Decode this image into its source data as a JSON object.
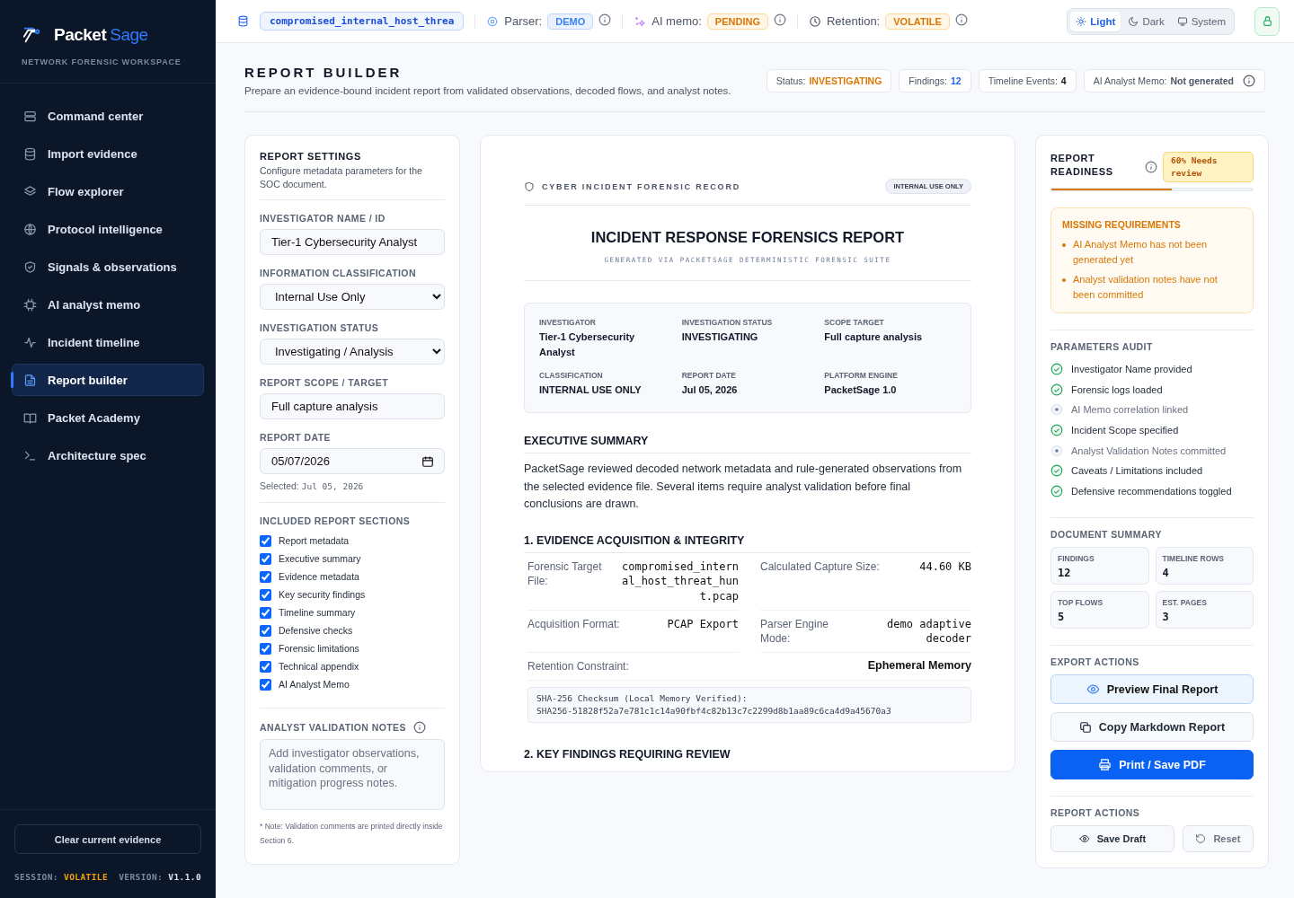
{
  "sidebar": {
    "brand": {
      "name_first": "Packet",
      "name_second": "Sage",
      "tagline": "NETWORK FORENSIC WORKSPACE"
    },
    "nav": [
      {
        "label": "Command center",
        "selected": false
      },
      {
        "label": "Import evidence",
        "selected": false
      },
      {
        "label": "Flow explorer",
        "selected": false
      },
      {
        "label": "Protocol intelligence",
        "selected": false
      },
      {
        "label": "Signals & observations",
        "selected": false
      },
      {
        "label": "AI analyst memo",
        "selected": false
      },
      {
        "label": "Incident timeline",
        "selected": false
      },
      {
        "label": "Report builder",
        "selected": true
      },
      {
        "label": "Packet Academy",
        "selected": false
      },
      {
        "label": "Architecture spec",
        "selected": false
      }
    ],
    "clear_button": "Clear current evidence",
    "session": {
      "label": "SESSION:",
      "value": "VOLATILE"
    },
    "version": {
      "label": "VERSION:",
      "value": "V1.1.0"
    }
  },
  "topbar": {
    "file": "compromised_internal_host_threa",
    "statuses": [
      {
        "label": "Parser:",
        "value": "DEMO",
        "kind": "info"
      },
      {
        "label": "AI memo:",
        "value": "PENDING",
        "kind": "warning"
      },
      {
        "label": "Retention:",
        "value": "VOLATILE",
        "kind": "warning"
      }
    ],
    "theme": [
      {
        "label": "Light",
        "selected": true
      },
      {
        "label": "Dark",
        "selected": false
      },
      {
        "label": "System",
        "selected": false
      }
    ]
  },
  "header": {
    "title": "REPORT BUILDER",
    "subtitle": "Prepare an evidence-bound incident report from validated observations, decoded flows, and analyst notes.",
    "stats": [
      {
        "label": "Status:",
        "value": "INVESTIGATING",
        "kind": "warning"
      },
      {
        "label": "Findings:",
        "value": "12",
        "kind": "info"
      },
      {
        "label": "Timeline Events:",
        "value": "4",
        "kind": "plain"
      },
      {
        "label": "AI Analyst Memo:",
        "value": "Not generated",
        "kind": "muted"
      }
    ]
  },
  "settings": {
    "title": "REPORT SETTINGS",
    "subtitle": "Configure metadata parameters for the SOC document.",
    "fields": [
      {
        "label": "INVESTIGATOR NAME / ID",
        "kind": "text",
        "value": "Tier-1 Cybersecurity Analyst"
      },
      {
        "label": "INFORMATION CLASSIFICATION",
        "kind": "select",
        "value": "Internal Use Only"
      },
      {
        "label": "INVESTIGATION STATUS",
        "kind": "select",
        "value": "Investigating / Analysis"
      },
      {
        "label": "REPORT SCOPE / TARGET",
        "kind": "text",
        "value": "Full capture analysis"
      },
      {
        "label": "REPORT DATE",
        "kind": "date",
        "value": "05/07/2026"
      }
    ],
    "date_hint": {
      "label": "Selected:",
      "value": "Jul 05, 2026"
    },
    "sections_title": "INCLUDED REPORT SECTIONS",
    "sections": [
      {
        "label": "Report metadata",
        "checked": true
      },
      {
        "label": "Executive summary",
        "checked": true
      },
      {
        "label": "Evidence metadata",
        "checked": true
      },
      {
        "label": "Key security findings",
        "checked": true
      },
      {
        "label": "Timeline summary",
        "checked": true
      },
      {
        "label": "Defensive checks",
        "checked": true
      },
      {
        "label": "Forensic limitations",
        "checked": true
      },
      {
        "label": "Technical appendix",
        "checked": true
      },
      {
        "label": "AI Analyst Memo",
        "checked": true
      }
    ],
    "notes": {
      "label": "ANALYST VALIDATION NOTES",
      "placeholder": "Add investigator observations, validation comments, or mitigation progress notes."
    },
    "note": "* Note: Validation comments are printed directly inside Section 6."
  },
  "report": {
    "record_label": "CYBER INCIDENT FORENSIC RECORD",
    "badge": "INTERNAL USE ONLY",
    "title": "INCIDENT RESPONSE FORENSICS REPORT",
    "subtitle": "GENERATED VIA PACKETSAGE DETERMINISTIC FORENSIC SUITE",
    "meta": [
      {
        "label": "INVESTIGATOR",
        "value": "Tier-1 Cybersecurity Analyst"
      },
      {
        "label": "INVESTIGATION STATUS",
        "value": "INVESTIGATING"
      },
      {
        "label": "SCOPE TARGET",
        "value": "Full capture analysis"
      },
      {
        "label": "CLASSIFICATION",
        "value": "INTERNAL USE ONLY"
      },
      {
        "label": "REPORT DATE",
        "value": "Jul 05, 2026"
      },
      {
        "label": "PLATFORM ENGINE",
        "value": "PacketSage 1.0"
      }
    ],
    "summary_title": "EXECUTIVE SUMMARY",
    "summary": "PacketSage reviewed decoded network metadata and rule-generated observations from the selected evidence file. Several items require analyst validation before final conclusions are drawn.",
    "evidence_title": "1. EVIDENCE ACQUISITION & INTEGRITY",
    "evidence": [
      {
        "label": "Forensic Target File:",
        "value": "compromised_internal_host_threat_hunt.pcap",
        "kind": "mono"
      },
      {
        "label": "Calculated Capture Size:",
        "value": "44.60 KB",
        "kind": "mono"
      },
      {
        "label": "Acquisition Format:",
        "value": "PCAP Export",
        "kind": "mono"
      },
      {
        "label": "Parser Engine Mode:",
        "value": "demo adaptive decoder",
        "kind": "mono"
      },
      {
        "label": "Retention Constraint:",
        "value": "Ephemeral Memory",
        "kind": "wide"
      }
    ],
    "checksum_label": "SHA-256 Checksum (Local Memory Verified):",
    "checksum": "SHA256-51828f52a7e781c1c14a90fbf4c82b13c7c2299d8b1aa89c6ca4d9a45670a3",
    "findings_title": "2. KEY FINDINGS REQUIRING REVIEW"
  },
  "readiness": {
    "title": "REPORT READINESS",
    "badge": "60% Needs review",
    "level": 0.6,
    "missing_title": "MISSING REQUIREMENTS",
    "missing": [
      "AI Analyst Memo has not been generated yet",
      "Analyst validation notes have not been committed"
    ],
    "audit_title": "PARAMETERS AUDIT",
    "audit": [
      {
        "label": "Investigator Name provided",
        "checked": true
      },
      {
        "label": "Forensic logs loaded",
        "checked": true
      },
      {
        "label": "AI Memo correlation linked",
        "checked": false
      },
      {
        "label": "Incident Scope specified",
        "checked": true
      },
      {
        "label": "Analyst Validation Notes committed",
        "checked": false
      },
      {
        "label": "Caveats / Limitations included",
        "checked": true
      },
      {
        "label": "Defensive recommendations toggled",
        "checked": true
      }
    ],
    "summary_title": "DOCUMENT SUMMARY",
    "summary": [
      {
        "label": "FINDINGS",
        "value": "12"
      },
      {
        "label": "TIMELINE ROWS",
        "value": "4"
      },
      {
        "label": "TOP FLOWS",
        "value": "5"
      },
      {
        "label": "EST. PAGES",
        "value": "3"
      }
    ],
    "export_title": "EXPORT ACTIONS",
    "export": [
      {
        "label": "Preview Final Report",
        "kind": "soft"
      },
      {
        "label": "Copy Markdown Report",
        "kind": "outline"
      },
      {
        "label": "Print / Save PDF",
        "kind": "primary"
      }
    ],
    "actions_title": "REPORT ACTIONS",
    "actions": [
      {
        "label": "Save Draft",
        "kind": "outline"
      },
      {
        "label": "Reset",
        "kind": "muted"
      }
    ]
  }
}
